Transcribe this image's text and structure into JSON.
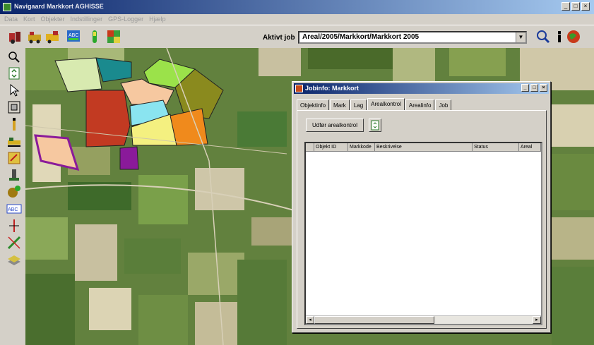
{
  "window": {
    "title": "Navigaard Markkort AGHISSE",
    "controls": [
      "_",
      "□",
      "×"
    ]
  },
  "menu": [
    "Data",
    "Kort",
    "Objekter",
    "Indstillinger",
    "GPS-Logger",
    "Hjælp"
  ],
  "toolbar": {
    "aktiv_job_label": "Aktivt job",
    "job_value": "Areal/2005/Markkort/Markkort 2005",
    "icons": [
      "tractor-icon",
      "trailer-icon",
      "harvester-icon",
      "abc-icon",
      "sprayer-icon",
      "field-icon",
      "search-icon",
      "info-icon",
      "globe-icon"
    ]
  },
  "left_tools": [
    "zoom-icon",
    "refresh-icon",
    "select-icon",
    "extent-icon",
    "pole-icon",
    "machine-icon",
    "edit-icon",
    "drill-icon",
    "paint-icon",
    "abc-label-icon",
    "cursor-icon",
    "measure-icon",
    "layer-icon"
  ],
  "dialog": {
    "title": "Jobinfo: Markkort",
    "controls": [
      "_",
      "□",
      "×"
    ],
    "tabs": [
      "Objektinfo",
      "Mark",
      "Lag",
      "Arealkontrol",
      "Arealinfo",
      "Job"
    ],
    "active_tab": "Arealkontrol",
    "udfor_button": "Udfør arealkontrol",
    "columns": [
      "",
      "Objekt ID",
      "Markkode",
      "Beskrivelse",
      "Status",
      "Areal"
    ],
    "scroll_left": "◂",
    "scroll_right": "▸"
  },
  "colors": {
    "titlebar": "#0a246a",
    "field_green": "#9be24a",
    "field_orange": "#f08a1c",
    "field_red": "#c23a22",
    "field_teal": "#1a8a8e",
    "field_olive": "#8a8a1e",
    "field_purple": "#8a1a9a",
    "field_yellow": "#f4f080",
    "field_peach": "#f6c8a0",
    "field_cyan": "#8ae4f0"
  }
}
